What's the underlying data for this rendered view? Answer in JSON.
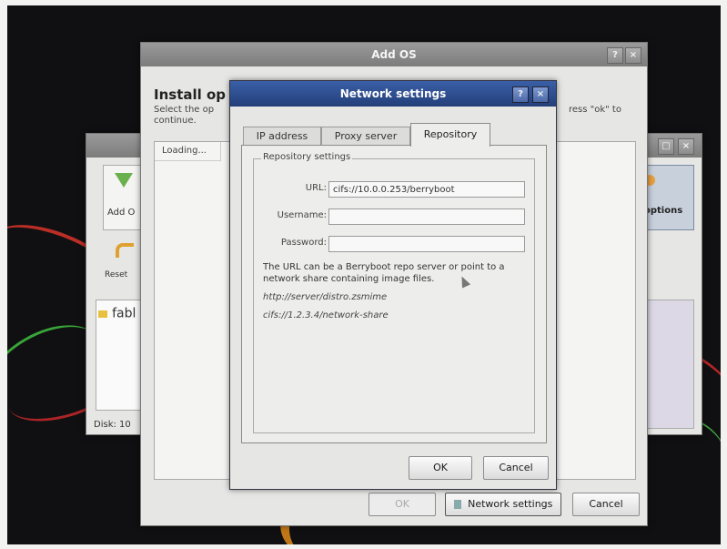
{
  "back_window": {
    "add_label": "Add O",
    "options_label": "options",
    "reset_label": "Reset",
    "list_item": "fabl",
    "disk_label": "Disk: 10"
  },
  "add_os": {
    "title": "Add OS",
    "help": "?",
    "close": "×",
    "heading": "Install op",
    "instr_left": "Select the op\ncontinue.",
    "instr_right": "ress \"ok\" to",
    "loading": "Loading...",
    "ok_label": "OK",
    "network_settings_label": "Network settings",
    "cancel_label": "Cancel"
  },
  "network": {
    "title": "Network settings",
    "help": "?",
    "close": "×",
    "tabs": [
      "IP address",
      "Proxy server",
      "Repository"
    ],
    "group_title": "Repository settings",
    "url_label": "URL:",
    "url_value": "cifs://10.0.0.253/berryboot",
    "username_label": "Username:",
    "username_value": "",
    "password_label": "Password:",
    "password_value": "",
    "description": "The URL can be a Berryboot repo server or point to a network share containing image files.",
    "example1": "http://server/distro.zsmime",
    "example2": "cifs://1.2.3.4/network-share",
    "ok_label": "OK",
    "cancel_label": "Cancel"
  },
  "colors": {
    "titlebar": "#7c7c7c",
    "active_titlebar": "#2f4f8f",
    "window_bg": "#e6e6e4"
  }
}
